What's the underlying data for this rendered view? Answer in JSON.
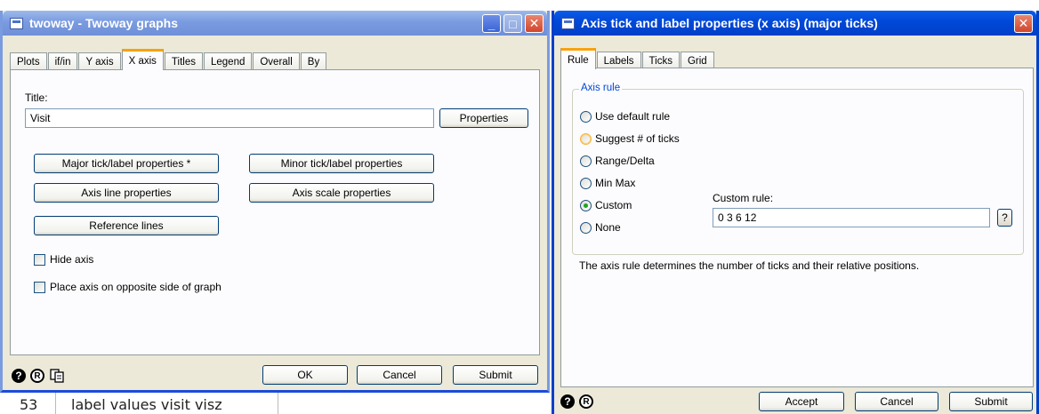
{
  "background": {
    "row_number": "53",
    "row_text": "label values visit visz"
  },
  "twoway_dialog": {
    "title": "twoway - Twoway graphs",
    "tabs": [
      {
        "label": "Plots"
      },
      {
        "label": "if/in"
      },
      {
        "label": "Y axis"
      },
      {
        "label": "X axis",
        "selected": true
      },
      {
        "label": "Titles"
      },
      {
        "label": "Legend"
      },
      {
        "label": "Overall"
      },
      {
        "label": "By"
      }
    ],
    "title_label": "Title:",
    "title_value": "Visit",
    "properties_button": "Properties",
    "major_tick_button": "Major tick/label properties *",
    "minor_tick_button": "Minor tick/label properties",
    "axis_line_button": "Axis line properties",
    "axis_scale_button": "Axis scale properties",
    "reference_lines_button": "Reference lines",
    "hide_axis_label": "Hide axis",
    "opposite_side_label": "Place axis on opposite side of graph",
    "ok_button": "OK",
    "cancel_button": "Cancel",
    "submit_button": "Submit"
  },
  "axis_dialog": {
    "title": "Axis tick and label properties (x axis) (major ticks)",
    "tabs": [
      {
        "label": "Rule",
        "selected": true
      },
      {
        "label": "Labels"
      },
      {
        "label": "Ticks"
      },
      {
        "label": "Grid"
      }
    ],
    "group_title": "Axis rule",
    "rules": [
      {
        "label": "Use default rule",
        "checked": false
      },
      {
        "label": "Suggest # of ticks",
        "checked": false
      },
      {
        "label": "Range/Delta",
        "checked": false
      },
      {
        "label": "Min Max",
        "checked": false
      },
      {
        "label": "Custom",
        "checked": true
      },
      {
        "label": "None",
        "checked": false
      }
    ],
    "custom_rule_label": "Custom rule:",
    "custom_rule_value": "0 3 6 12",
    "help_button": "?",
    "description": "The axis rule determines the number of ticks and their relative positions.",
    "accept_button": "Accept",
    "cancel_button": "Cancel",
    "submit_button": "Submit"
  },
  "colors": {
    "accent_active": "#0048d8",
    "accent_inactive": "#7a9be0",
    "tab_highlight": "#f8a20e",
    "group_title": "#0046d5",
    "dialog_face": "#ece9d8"
  },
  "icons": [
    "help-icon",
    "review-icon",
    "copy-icon",
    "minimize-icon",
    "maximize-icon",
    "close-icon"
  ]
}
